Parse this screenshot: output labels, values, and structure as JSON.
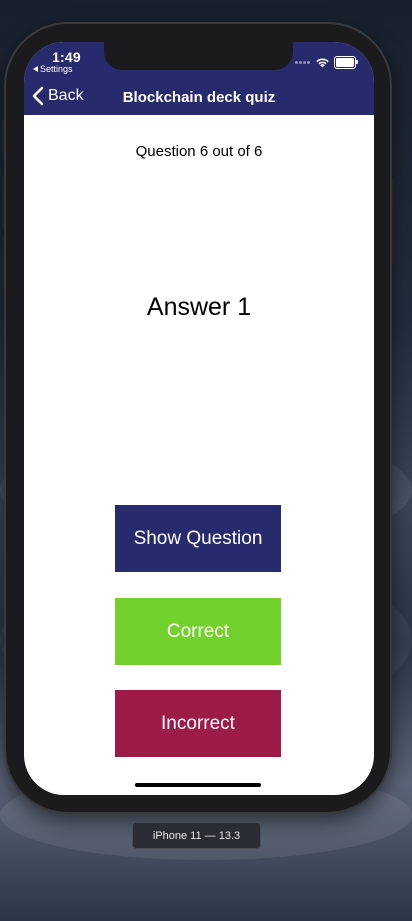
{
  "status_bar": {
    "time": "1:49",
    "back_app_label": "Settings"
  },
  "nav": {
    "back_label": "Back",
    "title": "Blockchain deck quiz"
  },
  "quiz": {
    "progress_text": "Question 6 out of 6",
    "card_text": "Answer 1"
  },
  "buttons": {
    "show_question": "Show Question",
    "correct": "Correct",
    "incorrect": "Incorrect"
  },
  "colors": {
    "nav_bg": "#282a6e",
    "show_question_bg": "#282a6e",
    "correct_bg": "#73d12d",
    "incorrect_bg": "#9c1c47"
  },
  "simulator": {
    "device_label": "iPhone 11 — 13.3"
  }
}
